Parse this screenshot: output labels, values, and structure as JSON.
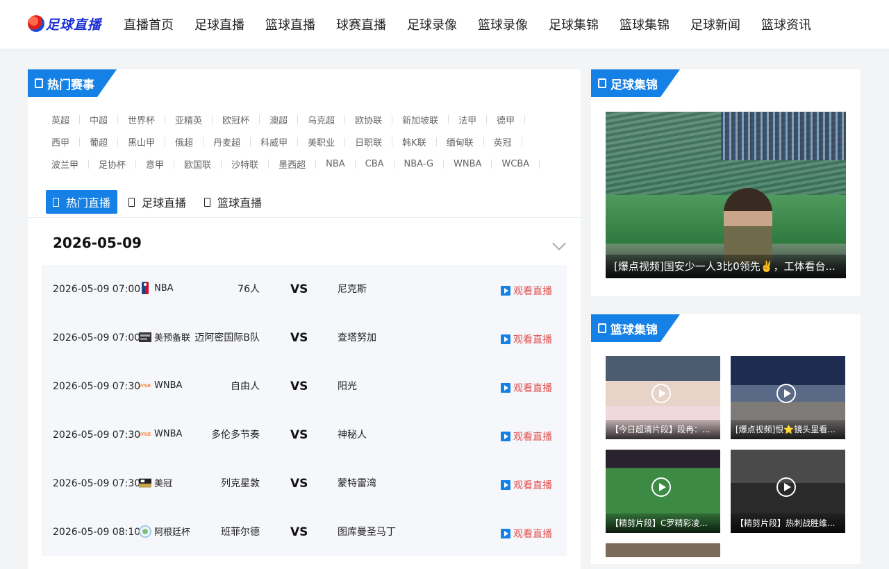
{
  "header": {
    "logo_text": "足球直播",
    "nav": [
      "直播首页",
      "足球直播",
      "篮球直播",
      "球赛直播",
      "足球录像",
      "篮球录像",
      "足球集锦",
      "篮球集锦",
      "足球新闻",
      "篮球资讯"
    ]
  },
  "hot_events": {
    "title": "热门赛事",
    "rows": [
      [
        "英超",
        "中超",
        "世界杯",
        "亚精英",
        "欧冠杯",
        "澳超",
        "乌克超",
        "欧协联",
        "新加坡联",
        "法甲",
        "德甲"
      ],
      [
        "西甲",
        "葡超",
        "黑山甲",
        "俄超",
        "丹麦超",
        "科威甲",
        "美职业",
        "日职联",
        "韩K联",
        "缅甸联",
        "英冠"
      ],
      [
        "波兰甲",
        "足协杯",
        "意甲",
        "欧国联",
        "沙特联",
        "墨西超",
        "NBA",
        "CBA",
        "NBA-G",
        "WNBA",
        "WCBA"
      ]
    ]
  },
  "tabs": [
    {
      "label": "热门直播",
      "active": true
    },
    {
      "label": "足球直播",
      "active": false
    },
    {
      "label": "篮球直播",
      "active": false
    }
  ],
  "date": "2026-05-09",
  "watch_label": "观看直播",
  "vs_label": "VS",
  "matches": [
    {
      "time": "2026-05-09 07:00",
      "league": "NBA",
      "league_icon": "nba-logo-icon",
      "home": "76人",
      "away": "尼克斯"
    },
    {
      "time": "2026-05-09 07:00",
      "league": "美预备联",
      "league_icon": "league-badge-icon",
      "home": "迈阿密国际B队",
      "away": "查塔努加"
    },
    {
      "time": "2026-05-09 07:30",
      "league": "WNBA",
      "league_icon": "wnba-logo-icon",
      "home": "自由人",
      "away": "阳光"
    },
    {
      "time": "2026-05-09 07:30",
      "league": "WNBA",
      "league_icon": "wnba-logo-icon",
      "home": "多伦多节奏",
      "away": "神秘人"
    },
    {
      "time": "2026-05-09 07:30",
      "league": "美冠",
      "league_icon": "usl-badge-icon",
      "home": "列克星敦",
      "away": "蒙特雷湾"
    },
    {
      "time": "2026-05-09 08:10",
      "league": "阿根廷杯",
      "league_icon": "argentina-cup-icon",
      "home": "班菲尔德",
      "away": "图库曼圣马丁"
    }
  ],
  "football_highlights": {
    "title": "足球集锦",
    "feature_caption": "[爆点视频]国安少一人3比0领先✌️，工体看台..."
  },
  "basketball_highlights": {
    "title": "篮球集锦",
    "videos": [
      {
        "caption": "【今日超清片段】段冉：..."
      },
      {
        "caption": "[爆点视频]恨⭐镜头里看..."
      },
      {
        "caption": "【精剪片段】C罗精彩凌..."
      },
      {
        "caption": "【精剪片段】热刺战胜维..."
      }
    ]
  },
  "colors": {
    "accent": "#1580e6",
    "watch_text": "#e04f4f",
    "match_bg": "#f5f7fa"
  }
}
